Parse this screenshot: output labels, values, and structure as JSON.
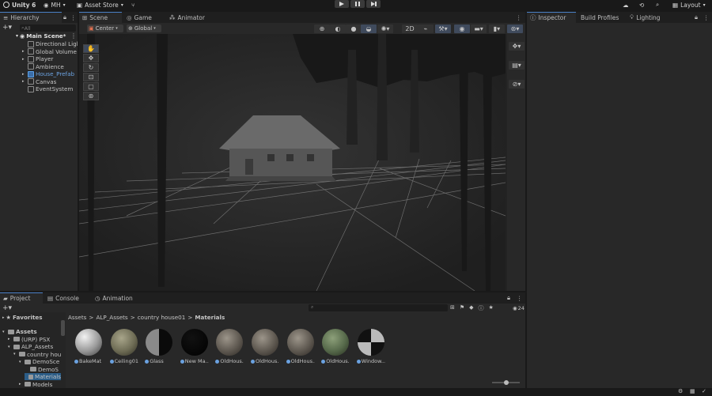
{
  "topbar": {
    "app_name": "Unity 6",
    "account": "MH",
    "asset_store": "Asset Store",
    "layout": "Layout"
  },
  "tabs": {
    "hierarchy": "Hierarchy",
    "scene": "Scene",
    "game": "Game",
    "animator": "Animator",
    "inspector": "Inspector",
    "build_profiles": "Build Profiles",
    "lighting": "Lighting",
    "project": "Project",
    "console": "Console",
    "animation": "Animation"
  },
  "hierarchy": {
    "search_placeholder": "All",
    "scene_name": "Main Scene*",
    "items": [
      {
        "label": "Directional Light",
        "prefab": false
      },
      {
        "label": "Global Volume",
        "prefab": false
      },
      {
        "label": "Player",
        "prefab": false
      },
      {
        "label": "Ambience",
        "prefab": false
      },
      {
        "label": "House_Prefab",
        "prefab": true
      },
      {
        "label": "Canvas",
        "prefab": false
      },
      {
        "label": "EventSystem",
        "prefab": false
      }
    ]
  },
  "scene_toolbar": {
    "pivot": "Center",
    "space": "Global"
  },
  "project": {
    "favorites": "Favorites",
    "tree": [
      {
        "label": "Assets",
        "depth": 0
      },
      {
        "label": "(URP) PSX",
        "depth": 1
      },
      {
        "label": "ALP_Assets",
        "depth": 1
      },
      {
        "label": "country hou",
        "depth": 2
      },
      {
        "label": "DemoSce",
        "depth": 3
      },
      {
        "label": "DemoS",
        "depth": 4
      },
      {
        "label": "Materials",
        "depth": 4
      },
      {
        "label": "Models",
        "depth": 3
      }
    ],
    "breadcrumb": [
      "Assets",
      "ALP_Assets",
      "country house01",
      "Materials"
    ],
    "count_badge": "24",
    "assets": [
      {
        "label": "BakeMat",
        "style": "white"
      },
      {
        "label": "Ceiling01",
        "style": "moss"
      },
      {
        "label": "Glass",
        "style": "half"
      },
      {
        "label": "New Ma...",
        "style": "black"
      },
      {
        "label": "OldHous...",
        "style": "wood"
      },
      {
        "label": "OldHous...",
        "style": "wood"
      },
      {
        "label": "OldHous...",
        "style": "wood"
      },
      {
        "label": "OldHous...",
        "style": "green"
      },
      {
        "label": "Window...",
        "style": "window"
      }
    ]
  },
  "colors": {
    "accent": "#4b80c6",
    "panel_bg": "#282828",
    "tab_bg": "#1f1f1f"
  }
}
